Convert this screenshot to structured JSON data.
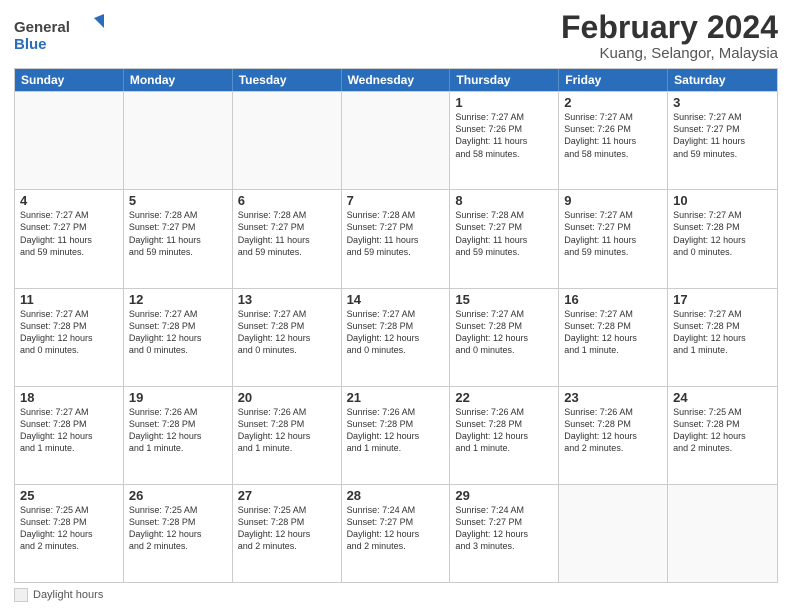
{
  "header": {
    "title": "February 2024",
    "location": "Kuang, Selangor, Malaysia",
    "logo_general": "General",
    "logo_blue": "Blue"
  },
  "calendar": {
    "days_header": [
      "Sunday",
      "Monday",
      "Tuesday",
      "Wednesday",
      "Thursday",
      "Friday",
      "Saturday"
    ],
    "legend_label": "Daylight hours",
    "rows": [
      {
        "cells": [
          {
            "day": "",
            "info": "",
            "empty": true
          },
          {
            "day": "",
            "info": "",
            "empty": true
          },
          {
            "day": "",
            "info": "",
            "empty": true
          },
          {
            "day": "",
            "info": "",
            "empty": true
          },
          {
            "day": "1",
            "info": "Sunrise: 7:27 AM\nSunset: 7:26 PM\nDaylight: 11 hours\nand 58 minutes."
          },
          {
            "day": "2",
            "info": "Sunrise: 7:27 AM\nSunset: 7:26 PM\nDaylight: 11 hours\nand 58 minutes."
          },
          {
            "day": "3",
            "info": "Sunrise: 7:27 AM\nSunset: 7:27 PM\nDaylight: 11 hours\nand 59 minutes."
          }
        ]
      },
      {
        "cells": [
          {
            "day": "4",
            "info": "Sunrise: 7:27 AM\nSunset: 7:27 PM\nDaylight: 11 hours\nand 59 minutes."
          },
          {
            "day": "5",
            "info": "Sunrise: 7:28 AM\nSunset: 7:27 PM\nDaylight: 11 hours\nand 59 minutes."
          },
          {
            "day": "6",
            "info": "Sunrise: 7:28 AM\nSunset: 7:27 PM\nDaylight: 11 hours\nand 59 minutes."
          },
          {
            "day": "7",
            "info": "Sunrise: 7:28 AM\nSunset: 7:27 PM\nDaylight: 11 hours\nand 59 minutes."
          },
          {
            "day": "8",
            "info": "Sunrise: 7:28 AM\nSunset: 7:27 PM\nDaylight: 11 hours\nand 59 minutes."
          },
          {
            "day": "9",
            "info": "Sunrise: 7:27 AM\nSunset: 7:27 PM\nDaylight: 11 hours\nand 59 minutes."
          },
          {
            "day": "10",
            "info": "Sunrise: 7:27 AM\nSunset: 7:28 PM\nDaylight: 12 hours\nand 0 minutes."
          }
        ]
      },
      {
        "cells": [
          {
            "day": "11",
            "info": "Sunrise: 7:27 AM\nSunset: 7:28 PM\nDaylight: 12 hours\nand 0 minutes."
          },
          {
            "day": "12",
            "info": "Sunrise: 7:27 AM\nSunset: 7:28 PM\nDaylight: 12 hours\nand 0 minutes."
          },
          {
            "day": "13",
            "info": "Sunrise: 7:27 AM\nSunset: 7:28 PM\nDaylight: 12 hours\nand 0 minutes."
          },
          {
            "day": "14",
            "info": "Sunrise: 7:27 AM\nSunset: 7:28 PM\nDaylight: 12 hours\nand 0 minutes."
          },
          {
            "day": "15",
            "info": "Sunrise: 7:27 AM\nSunset: 7:28 PM\nDaylight: 12 hours\nand 0 minutes."
          },
          {
            "day": "16",
            "info": "Sunrise: 7:27 AM\nSunset: 7:28 PM\nDaylight: 12 hours\nand 1 minute."
          },
          {
            "day": "17",
            "info": "Sunrise: 7:27 AM\nSunset: 7:28 PM\nDaylight: 12 hours\nand 1 minute."
          }
        ]
      },
      {
        "cells": [
          {
            "day": "18",
            "info": "Sunrise: 7:27 AM\nSunset: 7:28 PM\nDaylight: 12 hours\nand 1 minute."
          },
          {
            "day": "19",
            "info": "Sunrise: 7:26 AM\nSunset: 7:28 PM\nDaylight: 12 hours\nand 1 minute."
          },
          {
            "day": "20",
            "info": "Sunrise: 7:26 AM\nSunset: 7:28 PM\nDaylight: 12 hours\nand 1 minute."
          },
          {
            "day": "21",
            "info": "Sunrise: 7:26 AM\nSunset: 7:28 PM\nDaylight: 12 hours\nand 1 minute."
          },
          {
            "day": "22",
            "info": "Sunrise: 7:26 AM\nSunset: 7:28 PM\nDaylight: 12 hours\nand 1 minute."
          },
          {
            "day": "23",
            "info": "Sunrise: 7:26 AM\nSunset: 7:28 PM\nDaylight: 12 hours\nand 2 minutes."
          },
          {
            "day": "24",
            "info": "Sunrise: 7:25 AM\nSunset: 7:28 PM\nDaylight: 12 hours\nand 2 minutes."
          }
        ]
      },
      {
        "cells": [
          {
            "day": "25",
            "info": "Sunrise: 7:25 AM\nSunset: 7:28 PM\nDaylight: 12 hours\nand 2 minutes."
          },
          {
            "day": "26",
            "info": "Sunrise: 7:25 AM\nSunset: 7:28 PM\nDaylight: 12 hours\nand 2 minutes."
          },
          {
            "day": "27",
            "info": "Sunrise: 7:25 AM\nSunset: 7:28 PM\nDaylight: 12 hours\nand 2 minutes."
          },
          {
            "day": "28",
            "info": "Sunrise: 7:24 AM\nSunset: 7:27 PM\nDaylight: 12 hours\nand 2 minutes."
          },
          {
            "day": "29",
            "info": "Sunrise: 7:24 AM\nSunset: 7:27 PM\nDaylight: 12 hours\nand 3 minutes."
          },
          {
            "day": "",
            "info": "",
            "empty": true
          },
          {
            "day": "",
            "info": "",
            "empty": true
          }
        ]
      }
    ]
  }
}
